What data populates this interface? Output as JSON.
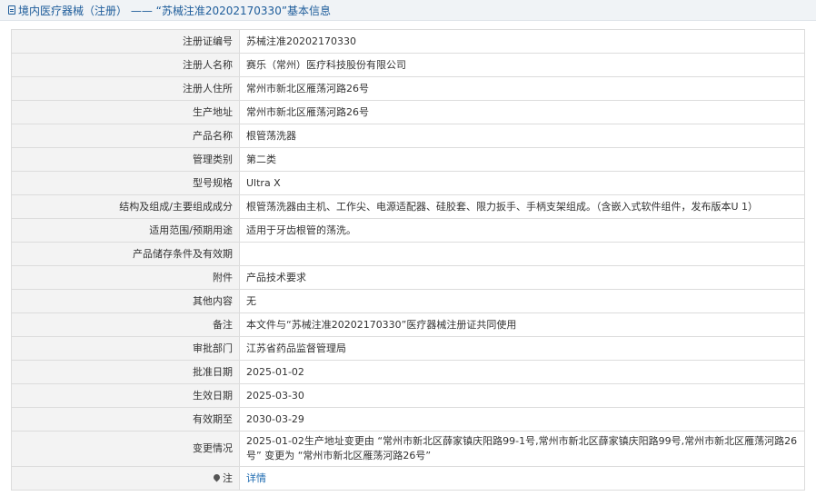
{
  "header": {
    "title": "境内医疗器械（注册） —— “苏械注准20202170330”基本信息"
  },
  "rows": [
    {
      "label": "注册证编号",
      "value": "苏械注准20202170330"
    },
    {
      "label": "注册人名称",
      "value": "赛乐（常州）医疗科技股份有限公司"
    },
    {
      "label": "注册人住所",
      "value": "常州市新北区雁荡河路26号"
    },
    {
      "label": "生产地址",
      "value": "常州市新北区雁荡河路26号"
    },
    {
      "label": "产品名称",
      "value": "根管荡洗器"
    },
    {
      "label": "管理类别",
      "value": "第二类"
    },
    {
      "label": "型号规格",
      "value": "Ultra X"
    },
    {
      "label": "结构及组成/主要组成成分",
      "value": "根管荡洗器由主机、工作尖、电源适配器、硅胶套、限力扳手、手柄支架组成。（含嵌入式软件组件，发布版本U 1）"
    },
    {
      "label": "适用范围/预期用途",
      "value": "适用于牙齿根管的荡洗。"
    },
    {
      "label": "产品储存条件及有效期",
      "value": ""
    },
    {
      "label": "附件",
      "value": "产品技术要求"
    },
    {
      "label": "其他内容",
      "value": "无"
    },
    {
      "label": "备注",
      "value": "本文件与“苏械注准20202170330”医疗器械注册证共同使用"
    },
    {
      "label": "审批部门",
      "value": "江苏省药品监督管理局"
    },
    {
      "label": "批准日期",
      "value": "2025-01-02"
    },
    {
      "label": "生效日期",
      "value": "2025-03-30"
    },
    {
      "label": "有效期至",
      "value": "2030-03-29"
    },
    {
      "label": "变更情况",
      "value": "2025-01-02生产地址变更由 “常州市新北区薛家镇庆阳路99-1号,常州市新北区薛家镇庆阳路99号,常州市新北区雁荡河路26号” 变更为 “常州市新北区雁荡河路26号”"
    }
  ],
  "note": {
    "label": "注",
    "icon": "pin-icon",
    "link": "详情"
  }
}
